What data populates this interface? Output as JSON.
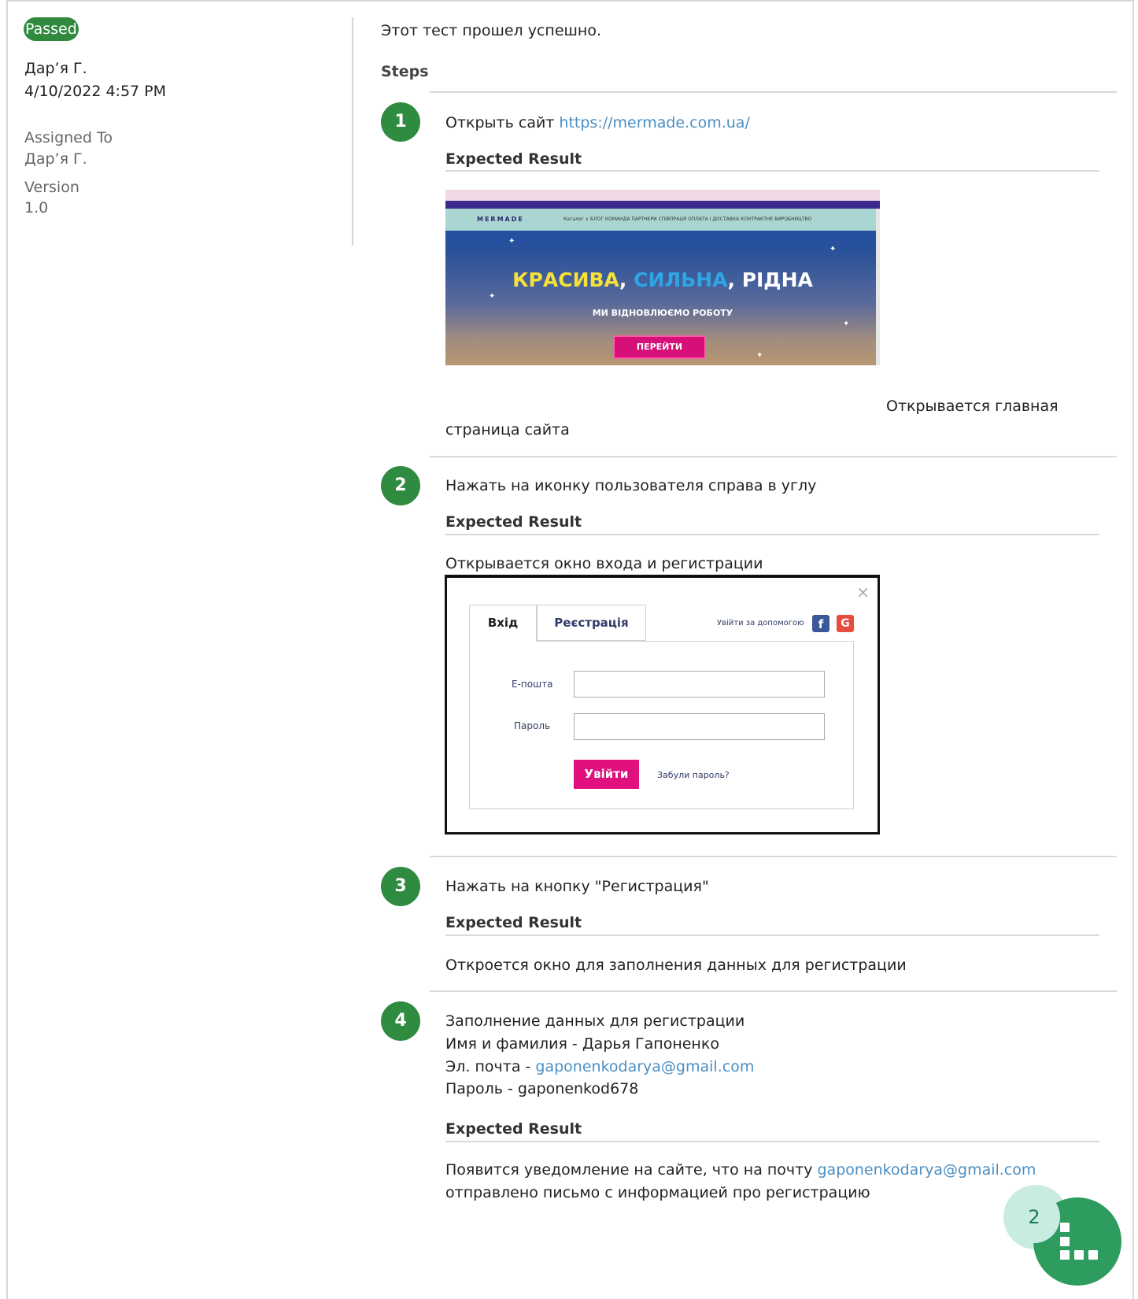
{
  "status": "Passed",
  "author": "Дар’я Г.",
  "date": "4/10/2022 4:57 PM",
  "meta": {
    "assigned_label": "Assigned To",
    "assigned_value": "Дар’я Г.",
    "version_label": "Version",
    "version_value": "1.0"
  },
  "summary": "Этот тест прошел успешно.",
  "steps_title": "Steps",
  "expected_label": "Expected Result",
  "steps": [
    {
      "number": "1",
      "action_prefix": "Открыть сайт ",
      "action_link": "https://mermade.com.ua/",
      "expected_line1": "Открывается главная",
      "expected_line2": "страница сайта"
    },
    {
      "number": "2",
      "action": "Нажать на иконку пользователя справа в углу",
      "expected": "Открывается окно входа и регистрации"
    },
    {
      "number": "3",
      "action": "Нажать на кнопку \"Регистрация\"",
      "expected": "Откроется окно для заполнения данных для регистрации"
    },
    {
      "number": "4",
      "action_line1": "Заполнение данных для регистрации",
      "action_line2": "Имя и фамилия - Дарья Гапоненко",
      "action_line3_prefix": "Эл. почта - ",
      "action_line3_link": "gaponenkodarya@gmail.com",
      "action_line4": "Пароль - gaponenkod678",
      "expected_prefix": "Появится уведомление на сайте, что на почту ",
      "expected_link": "gaponenkodarya@gmail.com",
      "expected_line2": "отправлено письмо с информацией про регистрацию"
    }
  ],
  "screenshot_site": {
    "logo": "MERMADE",
    "nav_text": "Каталог ∨   БЛОГ  КОМАНДА  ПАРТНЕРИ  СПІВПРАЦЯ  ОПЛАТА І ДОСТАВКА  КОНТРАКТНЕ ВИРОБНИЦТВО",
    "headline_1": "КРАСИВА",
    "headline_sep1": ", ",
    "headline_2": "СИЛЬНА",
    "headline_sep2": ", ",
    "headline_3": "РІДНА",
    "subheadline": "МИ ВІДНОВЛЮЄМО РОБОТУ",
    "button": "ПЕРЕЙТИ"
  },
  "screenshot_login": {
    "tab_login": "Вхід",
    "tab_register": "Реєстрація",
    "social_text": "Увійти за допомогою",
    "email_label": "Е-пошта",
    "password_label": "Пароль",
    "submit": "Увійти",
    "forgot": "Забули пароль?",
    "close_glyph": "×",
    "fb_glyph": "f",
    "google_glyph": "G"
  },
  "widget_badge": "2",
  "colors": {
    "status_green": "#2f8a3e",
    "step_green": "#2e8b3f",
    "link_blue": "#4a8fc4",
    "widget_green": "#2d9c5e"
  }
}
